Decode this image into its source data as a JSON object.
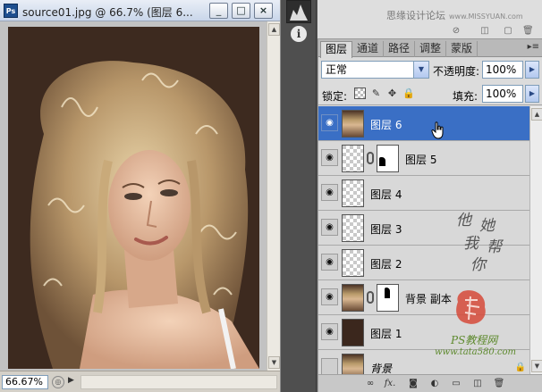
{
  "document": {
    "ps_badge": "Ps",
    "title": "source01.jpg @ 66.7% (图层 6...",
    "window_buttons": {
      "minimize": "_",
      "maximize": "□",
      "close": "×"
    },
    "zoom": "66.67%"
  },
  "top_strip": {
    "watermark_text": "思缘设计论坛",
    "watermark_url": "www.MISSYUAN.com",
    "info_glyph": "i"
  },
  "layers_panel": {
    "tabs": [
      {
        "label": "图层",
        "active": true
      },
      {
        "label": "通道",
        "active": false
      },
      {
        "label": "路径",
        "active": false
      },
      {
        "label": "调整",
        "active": false
      },
      {
        "label": "蒙版",
        "active": false
      }
    ],
    "blend_mode": "正常",
    "opacity_label": "不透明度:",
    "opacity_value": "100%",
    "lock_label": "锁定:",
    "fill_label": "填充:",
    "fill_value": "100%",
    "layers": [
      {
        "name": "图层 6",
        "selected": true,
        "visible": true,
        "thumb": "photo",
        "has_mask": false
      },
      {
        "name": "图层 5",
        "selected": false,
        "visible": true,
        "thumb": "checker",
        "has_mask": true
      },
      {
        "name": "图层 4",
        "selected": false,
        "visible": true,
        "thumb": "checker",
        "has_mask": false
      },
      {
        "name": "图层 3",
        "selected": false,
        "visible": true,
        "thumb": "checker",
        "has_mask": false
      },
      {
        "name": "图层 2",
        "selected": false,
        "visible": true,
        "thumb": "checker",
        "has_mask": false
      },
      {
        "name": "背景 副本",
        "selected": false,
        "visible": true,
        "thumb": "photo",
        "has_mask": true
      },
      {
        "name": "图层 1",
        "selected": false,
        "visible": true,
        "thumb": "brown",
        "has_mask": false
      },
      {
        "name": "背景",
        "selected": false,
        "visible": false,
        "thumb": "photo",
        "has_mask": false,
        "locked": true
      }
    ]
  },
  "overlay": {
    "signature_chars": [
      "他",
      "她",
      "我",
      "帮",
      "你"
    ],
    "footer_line1": "PS教程网",
    "footer_line2": "www.tata580.com"
  },
  "colors": {
    "selection": "#3a6fc5",
    "canvas_bg": "#3d2a1f",
    "panel_bg": "#dcdcdc"
  }
}
